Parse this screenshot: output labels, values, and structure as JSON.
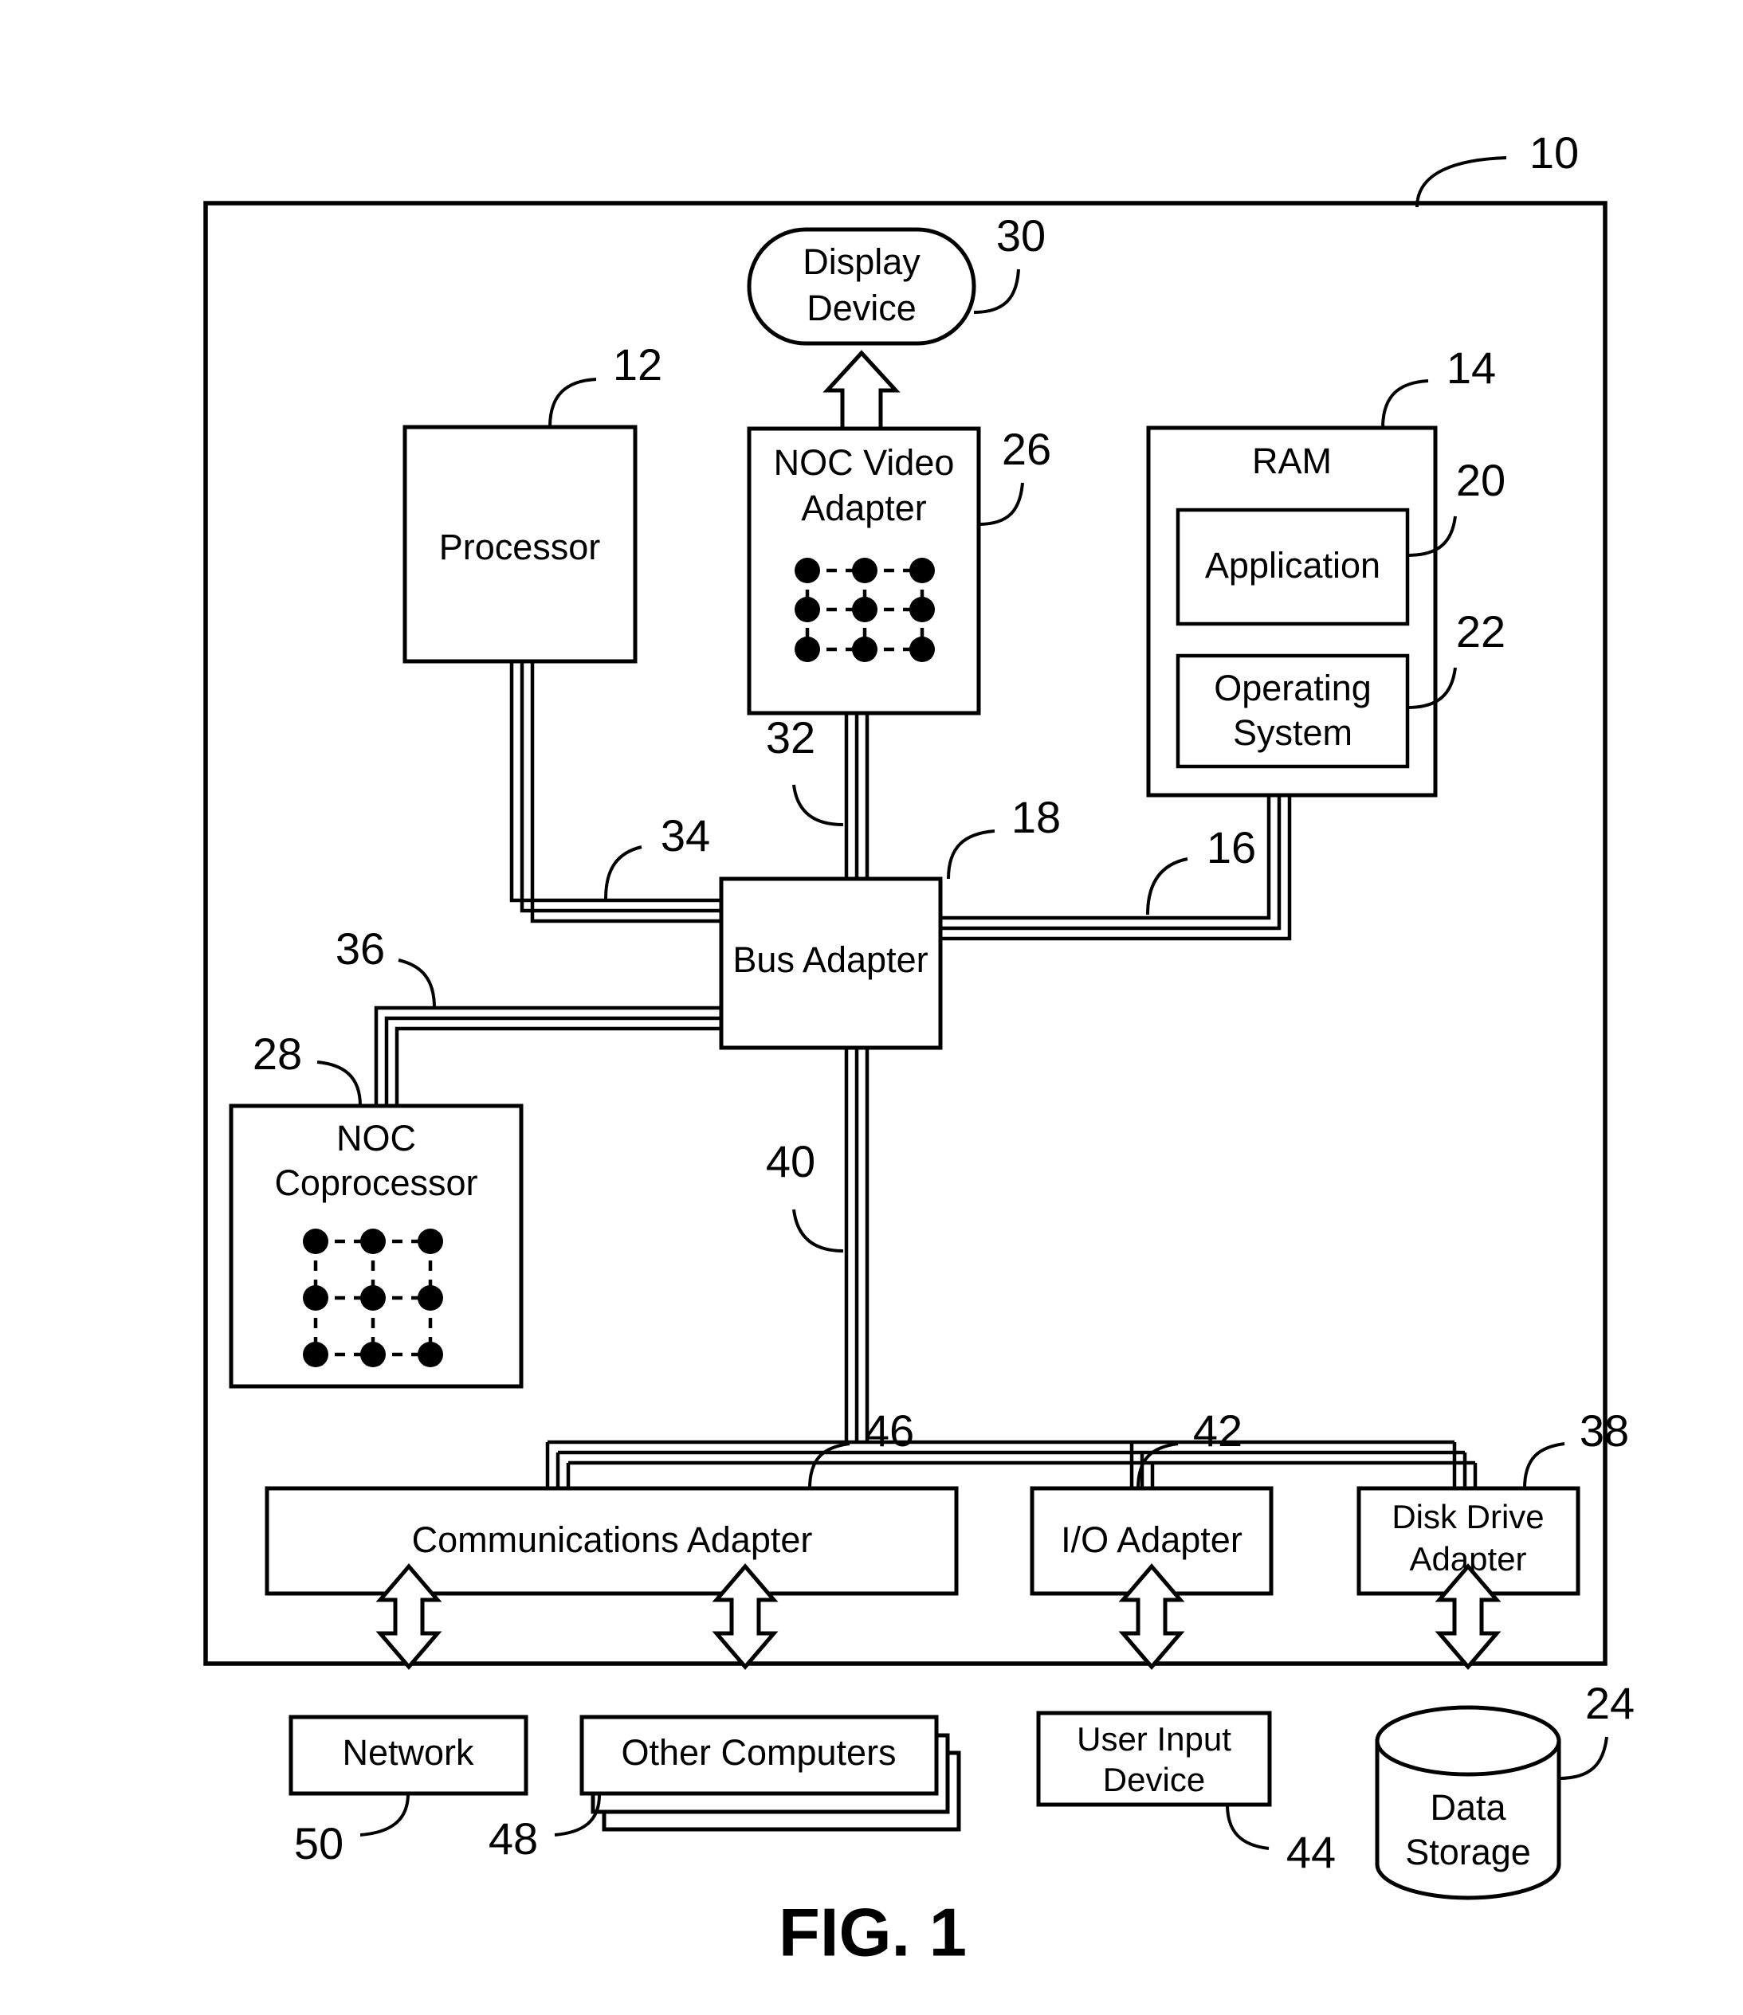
{
  "figure": {
    "caption": "FIG. 1",
    "system_ref": "10"
  },
  "blocks": {
    "display_device": {
      "label_line1": "Display",
      "label_line2": "Device",
      "ref": "30"
    },
    "processor": {
      "label": "Processor",
      "ref": "12"
    },
    "noc_video_adapter": {
      "label_line1": "NOC Video",
      "label_line2": "Adapter",
      "ref": "26"
    },
    "ram": {
      "label": "RAM",
      "ref": "14"
    },
    "application": {
      "label": "Application",
      "ref": "20"
    },
    "operating_system": {
      "label_line1": "Operating",
      "label_line2": "System",
      "ref": "22"
    },
    "bus_adapter": {
      "label": "Bus Adapter",
      "ref": "18"
    },
    "noc_coprocessor": {
      "label_line1": "NOC",
      "label_line2": "Coprocessor",
      "ref": "28"
    },
    "communications_adapter": {
      "label": "Communications Adapter",
      "ref": "46"
    },
    "io_adapter": {
      "label": "I/O Adapter",
      "ref": "42"
    },
    "disk_drive_adapter": {
      "label_line1": "Disk Drive",
      "label_line2": "Adapter",
      "ref": "38"
    },
    "network": {
      "label": "Network",
      "ref": "50"
    },
    "other_computers": {
      "label": "Other Computers",
      "ref": "48"
    },
    "user_input_device": {
      "label_line1": "User Input",
      "label_line2": "Device",
      "ref": "44"
    },
    "data_storage": {
      "label_line1": "Data",
      "label_line2": "Storage",
      "ref": "24"
    }
  },
  "buses": {
    "video_bus": {
      "ref": "32"
    },
    "front_side_bus": {
      "ref": "34"
    },
    "memory_bus": {
      "ref": "16"
    },
    "coprocessor_bus": {
      "ref": "36"
    },
    "expansion_bus": {
      "ref": "40"
    }
  },
  "style": {
    "line_color": "#000000",
    "fill_color": "#ffffff",
    "background": "#ffffff"
  }
}
